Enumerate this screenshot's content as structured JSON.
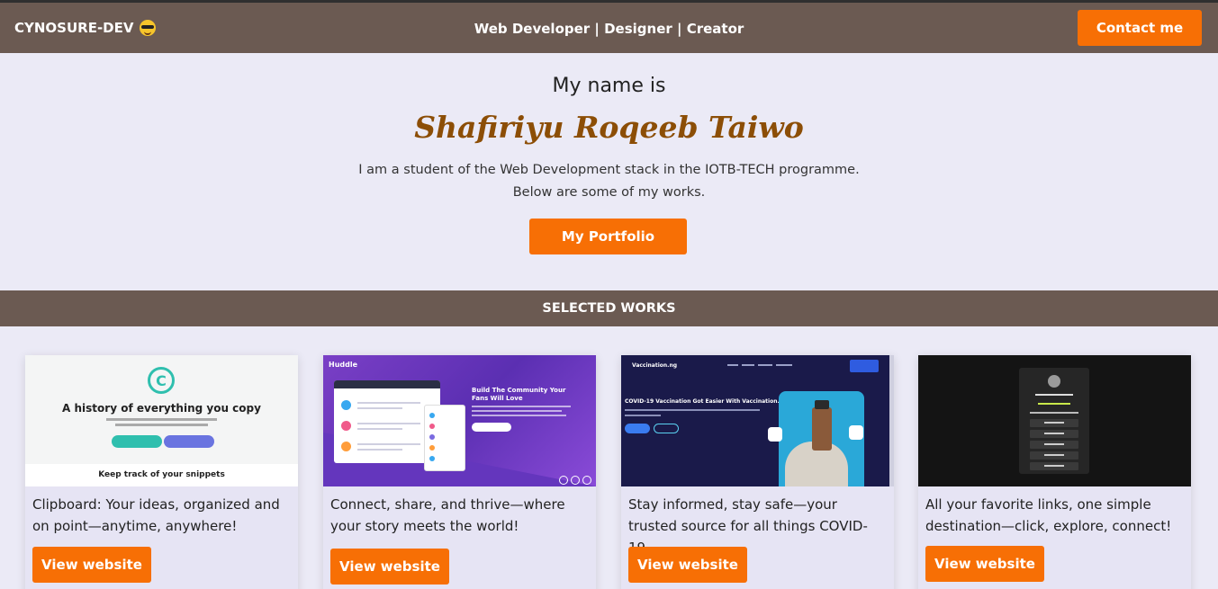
{
  "header": {
    "brand": "CYNOSURE-DEV",
    "brand_icon": "sunglasses-emoji-icon",
    "tagline": "Web Developer | Designer | Creator",
    "contact_label": "Contact me"
  },
  "hero": {
    "intro": "My name is",
    "name": "Shafiriyu Roqeeb Taiwo",
    "desc_line1": "I am a student of the Web Development stack in the IOTB-TECH programme.",
    "desc_line2": "Below are some of my works.",
    "portfolio_label": "My Portfolio"
  },
  "works": {
    "title": "SELECTED WORKS",
    "items": [
      {
        "desc": "Clipboard: Your ideas, organized and on point—anytime, anywhere!",
        "button": "View website",
        "thumb": {
          "heading": "A history of everything you copy",
          "footer": "Keep track of your snippets",
          "icon": "copyright-icon"
        }
      },
      {
        "desc": "Connect, share, and thrive—where your story meets the world!",
        "button": "View website",
        "thumb": {
          "brand": "Huddle",
          "heading": "Build The Community Your Fans Will Love"
        }
      },
      {
        "desc": "Stay informed, stay safe—your trusted source for all things COVID-19.",
        "button": "View website",
        "thumb": {
          "brand": "Vaccination.ng",
          "heading": "COVID-19 Vaccination Got Easier With Vaccination.ng"
        }
      },
      {
        "desc": "All your favorite links, one simple destination—click, explore, connect!",
        "button": "View website",
        "thumb": {}
      }
    ]
  },
  "colors": {
    "bar": "#6b5a52",
    "accent": "#f76f05",
    "background": "#ebeaf6",
    "name": "#8c4e06"
  }
}
